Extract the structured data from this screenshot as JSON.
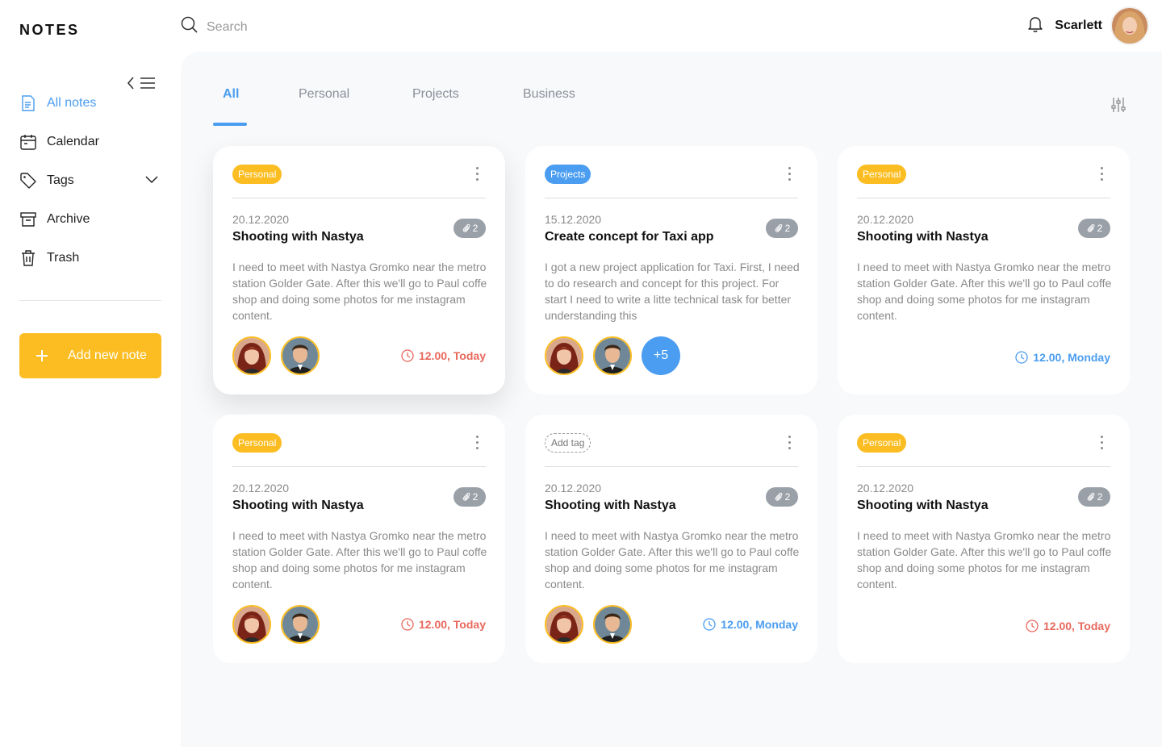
{
  "app": {
    "logo": "NOTES"
  },
  "header": {
    "search_placeholder": "Search",
    "username": "Scarlett"
  },
  "sidebar": {
    "items": [
      {
        "label": "All notes",
        "icon": "note-icon",
        "active": true
      },
      {
        "label": "Calendar",
        "icon": "calendar-icon"
      },
      {
        "label": "Tags",
        "icon": "tag-icon"
      },
      {
        "label": "Archive",
        "icon": "archive-icon"
      },
      {
        "label": "Trash",
        "icon": "trash-icon"
      }
    ],
    "add_button": "Add new note"
  },
  "tabs": [
    {
      "label": "All",
      "active": true
    },
    {
      "label": "Personal"
    },
    {
      "label": "Projects"
    },
    {
      "label": "Business"
    }
  ],
  "colors": {
    "accent": "#4a9df0",
    "yellow": "#fbbd22",
    "red": "#e8685d",
    "background": "#f8f9fb"
  },
  "notes": [
    {
      "tag": "Personal",
      "date": "20.12.2020",
      "title": "Shooting with Nastya",
      "attachments": "2",
      "body": "I need to meet with Nastya Gromko near the metro station Golder Gate. After this we'll go to Paul coffe shop and doing some photos for me instagram content.",
      "time": "12.00, Today"
    },
    {
      "tag": "Projects",
      "date": "15.12.2020",
      "title": "Create concept for Taxi app",
      "attachments": "2",
      "body": "I got a new project application for Taxi. First, I need to do research and concept for this project. For start I need to write a litte technical task for better understanding this",
      "more": "+5"
    },
    {
      "tag": "Personal",
      "date": "20.12.2020",
      "title": "Shooting with Nastya",
      "attachments": "2",
      "body": "I need to meet with Nastya Gromko near the metro station Golder Gate. After this we'll go to Paul coffe shop and doing some photos for me instagram content.",
      "time": "12.00, Monday"
    },
    {
      "tag": "Personal",
      "date": "20.12.2020",
      "title": "Shooting with Nastya",
      "attachments": "2",
      "body": "I need to meet with Nastya Gromko near the metro station Golder Gate. After this we'll go to Paul coffe shop and doing some photos for me instagram content.",
      "time": "12.00, Today"
    },
    {
      "tag": "Add tag",
      "date": "20.12.2020",
      "title": "Shooting with Nastya",
      "attachments": "2",
      "body": "I need to meet with Nastya Gromko near the metro station Golder Gate. After this we'll go to Paul coffe shop and doing some photos for me instagram content.",
      "time": "12.00, Monday"
    },
    {
      "tag": "Personal",
      "date": "20.12.2020",
      "title": "Shooting with Nastya",
      "attachments": "2",
      "body": "I need to meet with Nastya Gromko near the metro station Golder Gate. After this we'll go to Paul coffe shop and doing some photos for me instagram content.",
      "time": "12.00, Today"
    }
  ]
}
